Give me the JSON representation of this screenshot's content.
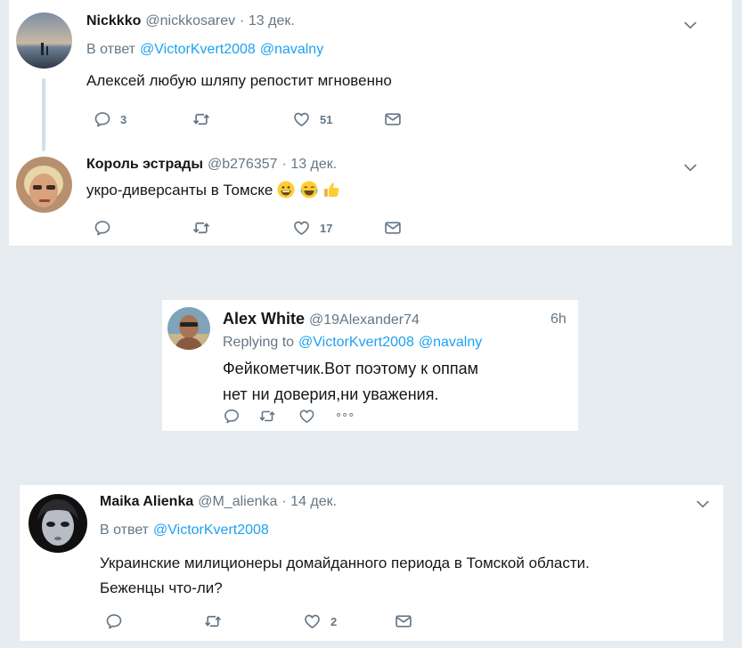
{
  "tweets": [
    {
      "name": "Nickkko",
      "handle": "@nickkosarev",
      "date": "· 13 дек.",
      "reply_label": "В ответ",
      "mentions": [
        "@VictorKvert2008",
        "@navalny"
      ],
      "text": "Алексей любую шляпу репостит мгновенно",
      "replies": "3",
      "likes": "51"
    },
    {
      "name": "Король эстрады",
      "handle": "@b276357",
      "date": "· 13 дек.",
      "text": "укро-диверсанты в Томске",
      "emojis": [
        "grinning-face",
        "tears-of-joy-face",
        "thumbs-up"
      ],
      "likes": "17"
    },
    {
      "name": "Alex White",
      "handle": "@19Alexander74",
      "time": "6h",
      "reply_label": "Replying to",
      "mentions": [
        "@VictorKvert2008",
        "@navalny"
      ],
      "text_lines": [
        "Фейкометчик.Вот поэтому к оппам",
        "нет ни доверия,ни уважения."
      ],
      "more": "∘∘∘"
    },
    {
      "name": "Maika Alienka",
      "handle": "@M_alienka",
      "date": "· 14 дек.",
      "reply_label": "В ответ",
      "mentions": [
        "@VictorKvert2008"
      ],
      "text_lines": [
        "Украинские милиционеры домайданного периода в Томской области.",
        "Беженцы что-ли?"
      ],
      "likes": "2"
    }
  ],
  "colors": {
    "background": "#e6ecf0",
    "link": "#1da1f2",
    "muted": "#657786",
    "thread_line": "#cce0ef"
  },
  "icons": [
    "reply-icon",
    "retweet-icon",
    "like-icon",
    "message-icon",
    "chevron-down-icon",
    "more-icon"
  ]
}
